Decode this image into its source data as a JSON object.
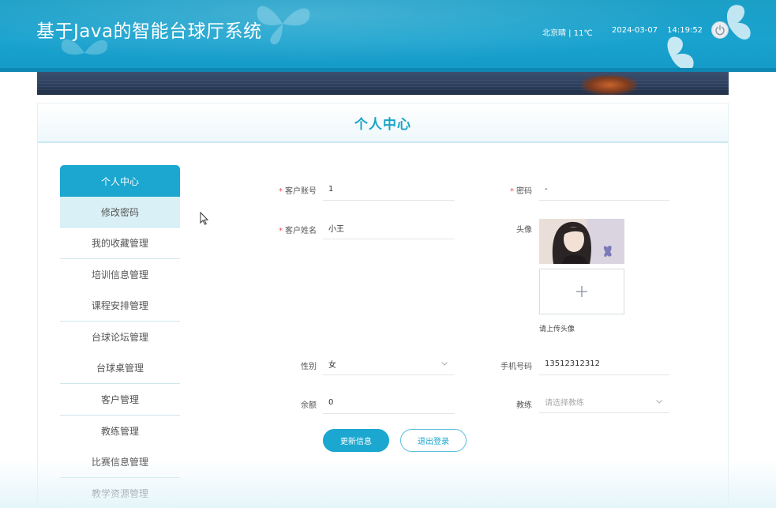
{
  "header": {
    "title": "基于Java的智能台球厅系统",
    "weather": "北京晴 | 11℃",
    "date": "2024-03-07",
    "time": "14:19:52"
  },
  "card": {
    "title": "个人中心"
  },
  "sidebar": {
    "items": [
      {
        "label": "个人中心"
      },
      {
        "label": "修改密码"
      },
      {
        "label": "我的收藏管理"
      },
      {
        "label": "培训信息管理"
      },
      {
        "label": "课程安排管理"
      },
      {
        "label": "台球论坛管理"
      },
      {
        "label": "台球桌管理"
      },
      {
        "label": "客户管理"
      },
      {
        "label": "教练管理"
      },
      {
        "label": "比赛信息管理"
      },
      {
        "label": "教学资源管理"
      }
    ]
  },
  "form": {
    "required_mark": "*",
    "account": {
      "label": "客户账号",
      "value": "1"
    },
    "password": {
      "label": "密码",
      "value": "-"
    },
    "name": {
      "label": "客户姓名",
      "value": "小王"
    },
    "avatar": {
      "label": "头像",
      "upload_hint": "请上传头像"
    },
    "gender": {
      "label": "性别",
      "value": "女"
    },
    "phone": {
      "label": "手机号码",
      "value": "13512312312"
    },
    "balance": {
      "label": "余额",
      "value": "0"
    },
    "coach": {
      "label": "教练",
      "placeholder": "请选择教练"
    }
  },
  "buttons": {
    "update": "更新信息",
    "logout": "退出登录"
  },
  "colors": {
    "accent": "#1ba7cf",
    "header": "#1aa3cf",
    "required": "#e94f4f"
  },
  "icons": [
    "power-icon",
    "chevron-down-icon",
    "plus-icon",
    "cursor-icon",
    "butterfly-icon"
  ]
}
